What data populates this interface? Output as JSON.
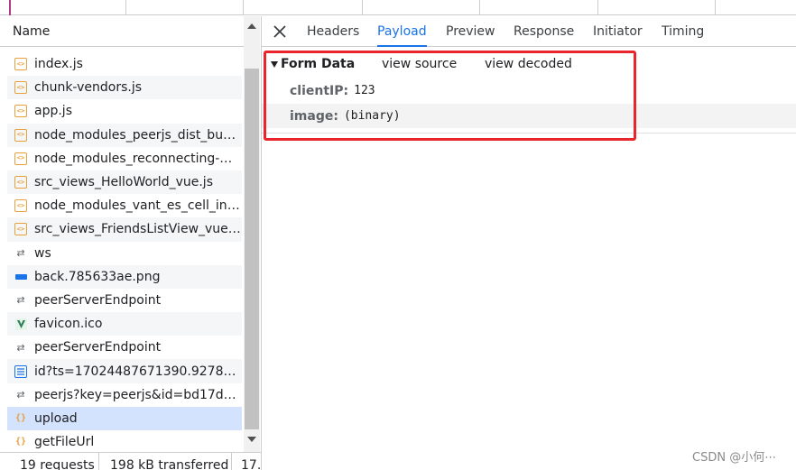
{
  "network_list": {
    "column_header": "Name",
    "items": [
      {
        "label": "index.js",
        "icon": "script-icon"
      },
      {
        "label": "chunk-vendors.js",
        "icon": "script-icon"
      },
      {
        "label": "app.js",
        "icon": "script-icon"
      },
      {
        "label": "node_modules_peerjs_dist_bundl...",
        "icon": "script-icon"
      },
      {
        "label": "node_modules_reconnecting-we...",
        "icon": "script-icon"
      },
      {
        "label": "src_views_HelloWorld_vue.js",
        "icon": "script-icon"
      },
      {
        "label": "node_modules_vant_es_cell_inde...",
        "icon": "script-icon"
      },
      {
        "label": "src_views_FriendsListView_vue.js",
        "icon": "script-icon"
      },
      {
        "label": "ws",
        "icon": "websocket-icon"
      },
      {
        "label": "back.785633ae.png",
        "icon": "image-icon"
      },
      {
        "label": "peerServerEndpoint",
        "icon": "websocket-icon"
      },
      {
        "label": "favicon.ico",
        "icon": "favicon-icon"
      },
      {
        "label": "peerServerEndpoint",
        "icon": "websocket-icon"
      },
      {
        "label": "id?ts=17024487671390.9278784...",
        "icon": "document-icon"
      },
      {
        "label": "peerjs?key=peerjs&id=bd17def2...",
        "icon": "websocket-icon"
      },
      {
        "label": "upload",
        "icon": "json-icon",
        "selected": true
      },
      {
        "label": "getFileUrl",
        "icon": "json-icon"
      }
    ]
  },
  "status_bar": {
    "requests": "19 requests",
    "transferred": "198 kB transferred",
    "resources": "17."
  },
  "detail_tabs": {
    "items": [
      "Headers",
      "Payload",
      "Preview",
      "Response",
      "Initiator",
      "Timing"
    ],
    "active": "Payload"
  },
  "payload": {
    "section_title": "Form Data",
    "view_source": "view source",
    "view_decoded": "view decoded",
    "fields": [
      {
        "key": "clientIP:",
        "value": "123"
      },
      {
        "key": "image:",
        "value": "(binary)"
      }
    ]
  },
  "watermark": "CSDN @小何⋯",
  "colors": {
    "accent": "#1a73e8",
    "selected_row": "#d3e3fd",
    "highlight_box": "#e8262b",
    "script_icon": "#e8a03c"
  }
}
